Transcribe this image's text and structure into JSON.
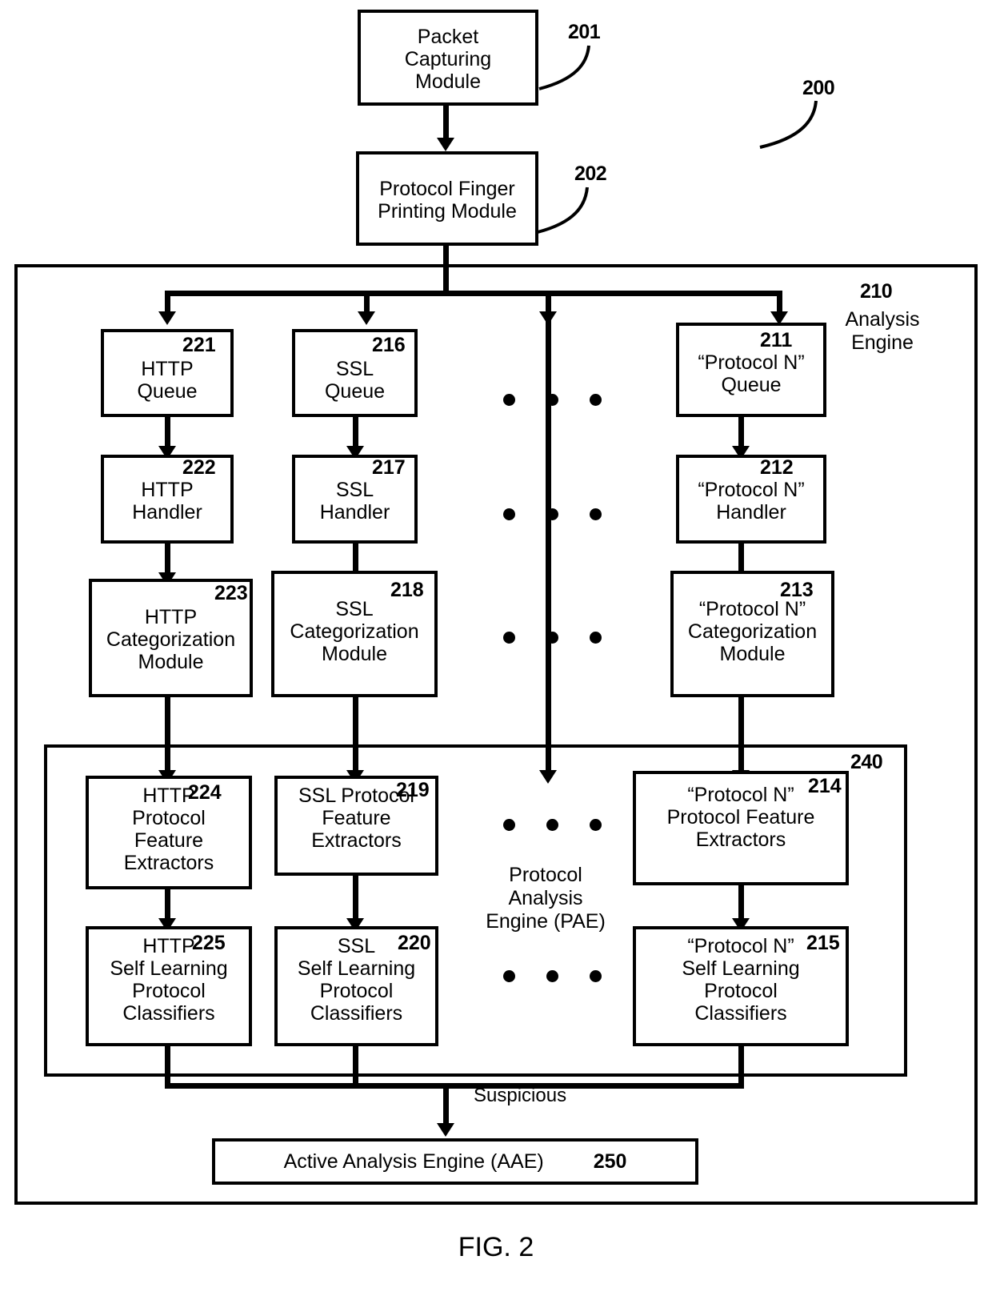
{
  "figure": {
    "caption": "FIG. 2",
    "system_ref": "200"
  },
  "top_modules": [
    {
      "id": "packet-capturing-module",
      "lines": [
        "Packet",
        "Capturing",
        "Module"
      ],
      "ref": "201"
    },
    {
      "id": "protocol-finger-printing-module",
      "lines": [
        "Protocol Finger",
        "Printing Module"
      ],
      "ref": "202"
    }
  ],
  "analysis_engine": {
    "ref": "210",
    "label_lines": [
      "Analysis",
      "Engine"
    ]
  },
  "pae": {
    "ref": "240",
    "label_lines": [
      "Protocol",
      "Analysis",
      "Engine (PAE)"
    ]
  },
  "columns": [
    {
      "name": "http",
      "queue": {
        "ref": "221",
        "lines": [
          "HTTP",
          "Queue"
        ]
      },
      "handler": {
        "ref": "222",
        "lines": [
          "HTTP",
          "Handler"
        ]
      },
      "categorization": {
        "ref": "223",
        "lines": [
          "HTTP",
          "Categorization",
          "Module"
        ]
      },
      "extractors": {
        "ref": "224",
        "lines": [
          "HTTP",
          "Protocol",
          "Feature",
          "Extractors"
        ]
      },
      "classifiers": {
        "ref": "225",
        "lines": [
          "HTTP",
          "Self Learning",
          "Protocol",
          "Classifiers"
        ]
      }
    },
    {
      "name": "ssl",
      "queue": {
        "ref": "216",
        "lines": [
          "SSL",
          "Queue"
        ]
      },
      "handler": {
        "ref": "217",
        "lines": [
          "SSL",
          "Handler"
        ]
      },
      "categorization": {
        "ref": "218",
        "lines": [
          "SSL",
          "Categorization",
          "Module"
        ]
      },
      "extractors": {
        "ref": "219",
        "lines": [
          "SSL Protocol",
          "Feature",
          "Extractors"
        ]
      },
      "classifiers": {
        "ref": "220",
        "lines": [
          "SSL",
          "Self Learning",
          "Protocol",
          "Classifiers"
        ]
      }
    },
    {
      "name": "protocol-n",
      "queue": {
        "ref": "211",
        "lines": [
          "“Protocol N”",
          "Queue"
        ]
      },
      "handler": {
        "ref": "212",
        "lines": [
          "“Protocol N”",
          "Handler"
        ]
      },
      "categorization": {
        "ref": "213",
        "lines": [
          "“Protocol N”",
          "Categorization",
          "Module"
        ]
      },
      "extractors": {
        "ref": "214",
        "lines": [
          "“Protocol N”",
          "Protocol Feature",
          "Extractors"
        ]
      },
      "classifiers": {
        "ref": "215",
        "lines": [
          "“Protocol N”",
          "Self Learning",
          "Protocol",
          "Classifiers"
        ]
      }
    }
  ],
  "edges": {
    "suspicious_label": "Suspicious"
  },
  "aae": {
    "label": "Active Analysis Engine (AAE)",
    "ref": "250"
  },
  "colors": {
    "stroke": "#000000",
    "background": "#ffffff"
  }
}
